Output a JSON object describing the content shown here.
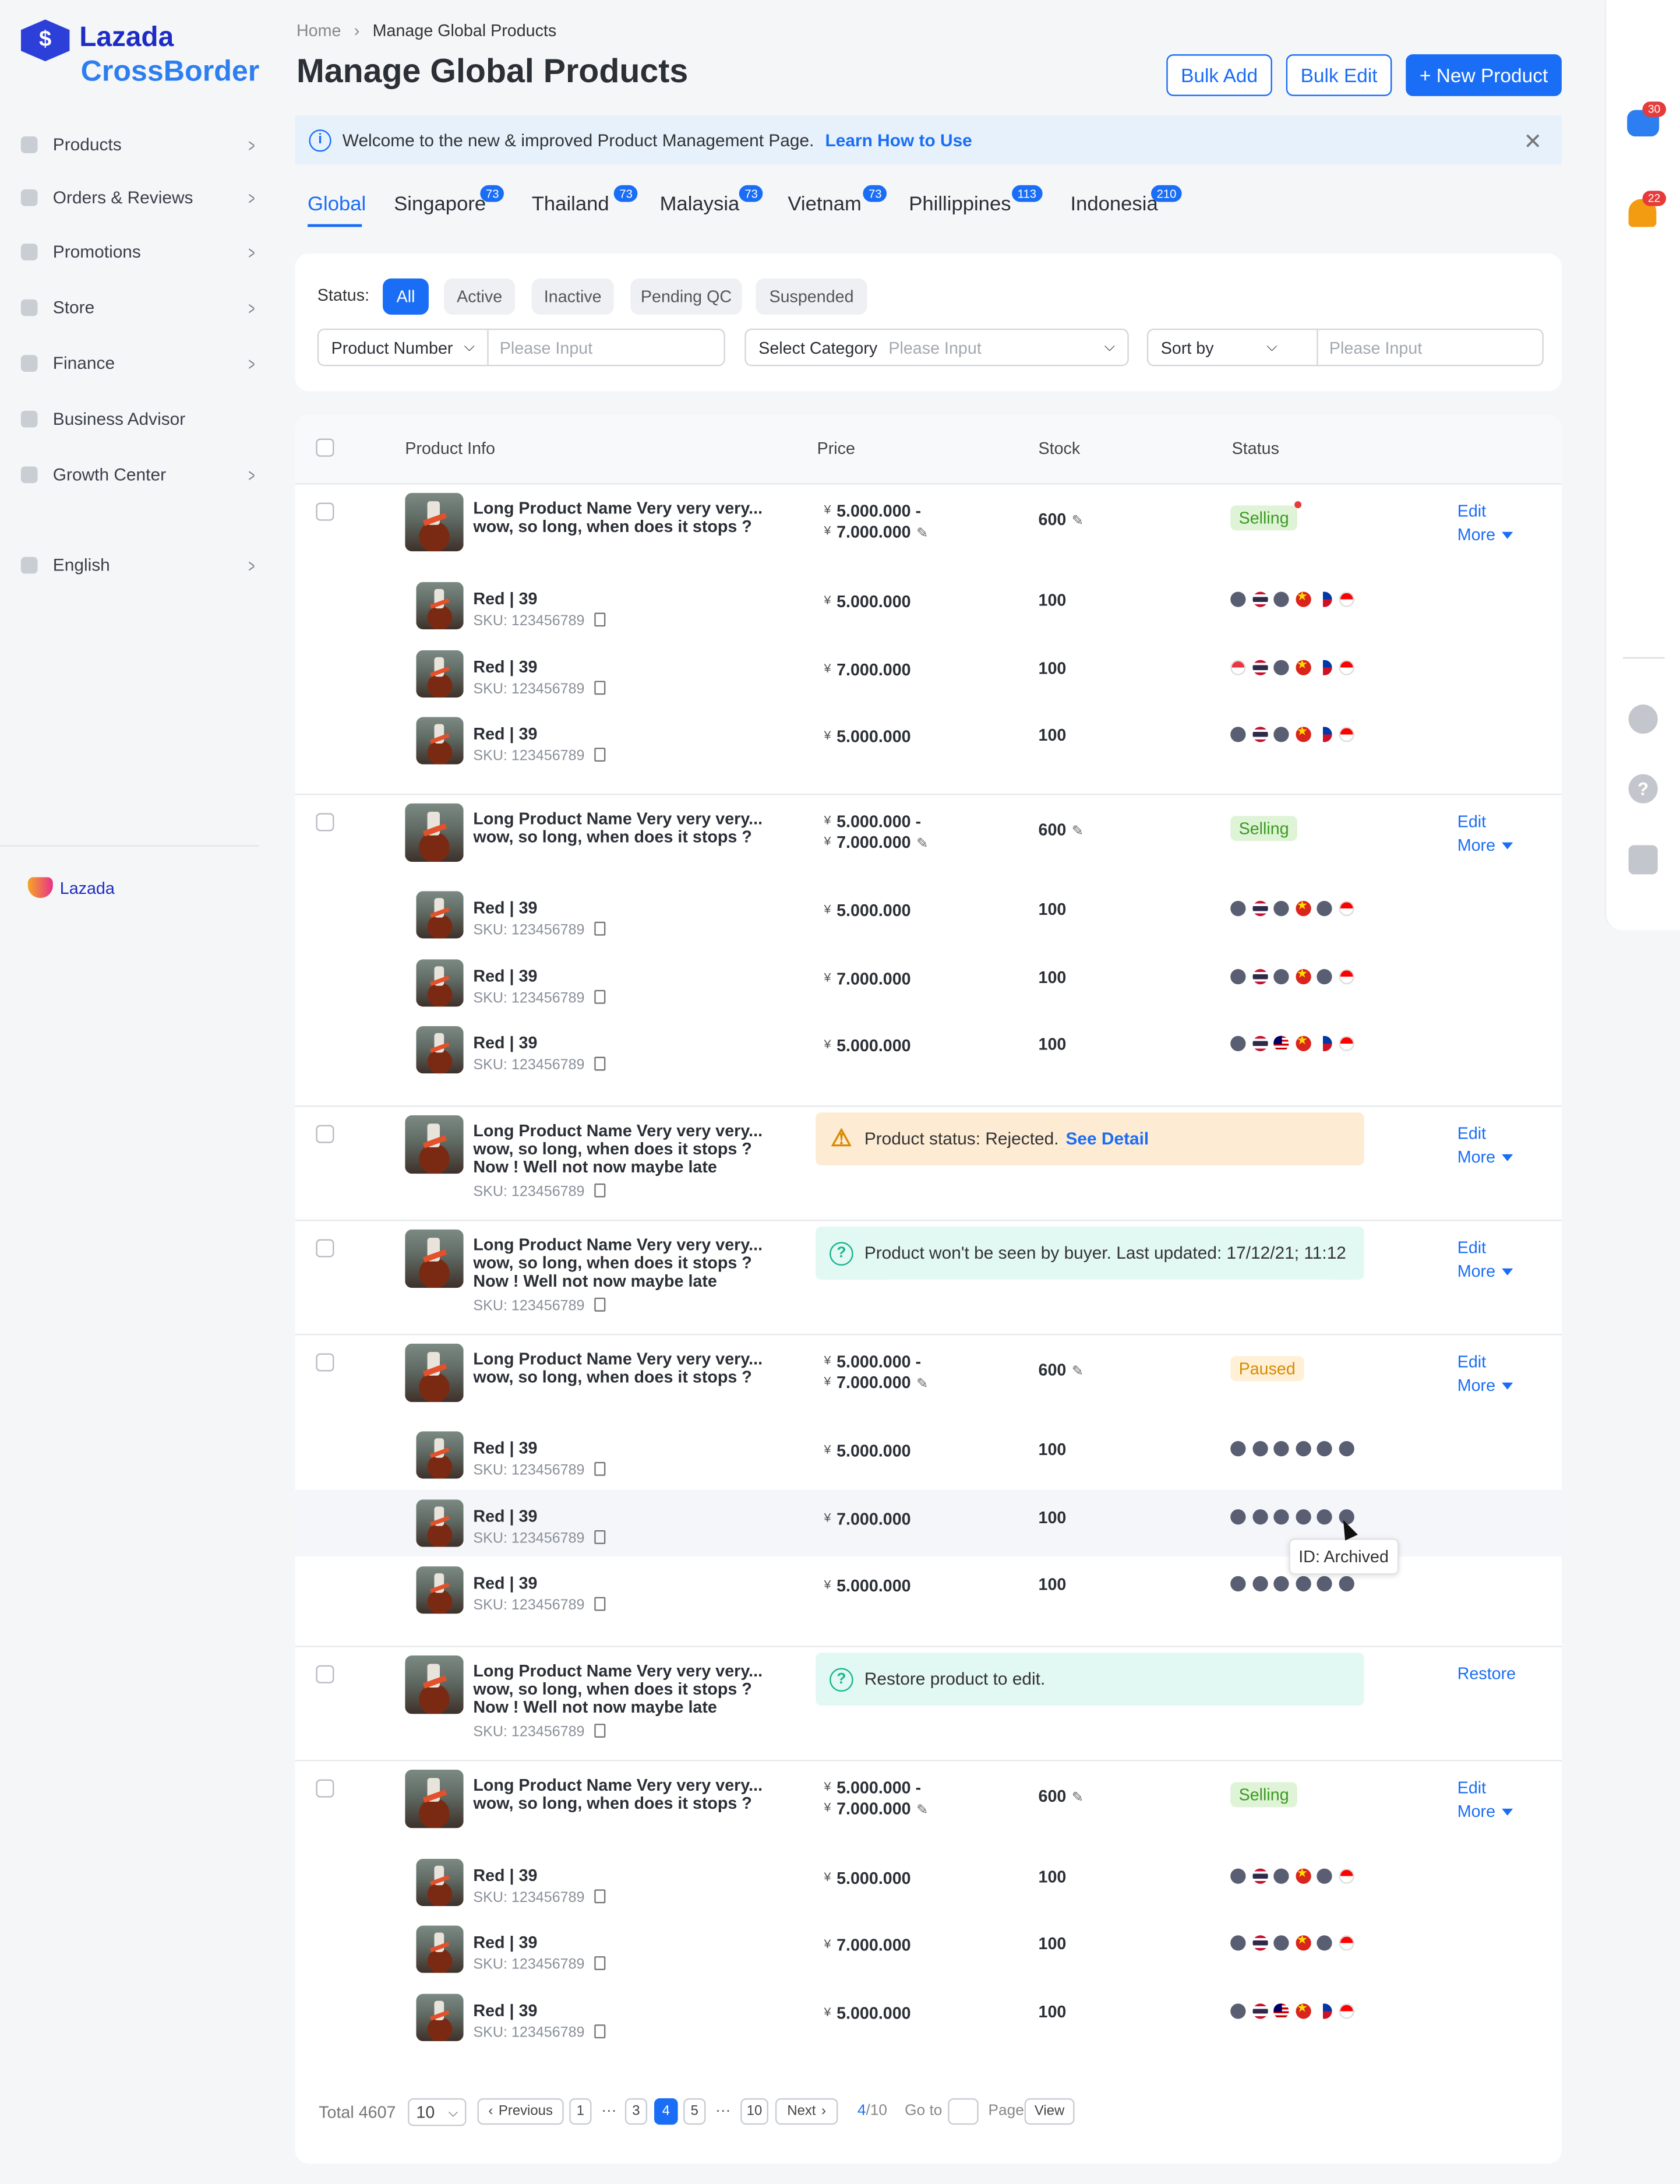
{
  "brand": {
    "name": "Lazada",
    "sub": "CrossBorder",
    "footer": "Lazada"
  },
  "sidebar": {
    "items": [
      {
        "label": "Products",
        "icon": "box-icon"
      },
      {
        "label": "Orders & Reviews",
        "icon": "orders-icon"
      },
      {
        "label": "Promotions",
        "icon": "promo-icon"
      },
      {
        "label": "Store",
        "icon": "store-icon"
      },
      {
        "label": "Finance",
        "icon": "finance-icon"
      },
      {
        "label": "Business Advisor",
        "icon": "advisor-icon"
      },
      {
        "label": "Growth Center",
        "icon": "growth-icon"
      },
      {
        "label": "English",
        "icon": "language-icon"
      }
    ]
  },
  "breadcrumb": {
    "home": "Home",
    "current": "Manage Global Products"
  },
  "title": "Manage Global Products",
  "buttons": {
    "bulk_add": "Bulk Add",
    "bulk_edit": "Bulk Edit",
    "new_product": "+ New Product"
  },
  "notice": {
    "text": "Welcome to the new & improved Product Management Page.",
    "link": "Learn How to Use"
  },
  "tabs": [
    {
      "label": "Global",
      "badge": ""
    },
    {
      "label": "Singapore",
      "badge": "73"
    },
    {
      "label": "Thailand",
      "badge": "73"
    },
    {
      "label": "Malaysia",
      "badge": "73"
    },
    {
      "label": "Vietnam",
      "badge": "73"
    },
    {
      "label": "Phillippines",
      "badge": "113"
    },
    {
      "label": "Indonesia",
      "badge": "210"
    }
  ],
  "filters": {
    "status_label": "Status:",
    "statuses": [
      "All",
      "Active",
      "Inactive",
      "Pending QC",
      "Suspended"
    ],
    "product_number": "Product Number",
    "placeholder": "Please Input",
    "category": "Select Category",
    "sort": "Sort by"
  },
  "table": {
    "headers": [
      "Product Info",
      "Price",
      "Stock",
      "Status"
    ]
  },
  "text": {
    "name": "Long Product Name Very very very...",
    "name2": "wow, so long, when does it stops ?",
    "name3": "Now ! Well not now maybe late",
    "sku": "SKU: 123456789",
    "variant": "Red | 39",
    "yen": "¥",
    "range1": "5.000.000 -",
    "range2": "7.000.000",
    "p5": "5.000.000",
    "p7": "7.000.000",
    "stock": "600",
    "vstock": "100",
    "edit": "Edit",
    "more": "More",
    "restore": "Restore",
    "selling": "Selling",
    "paused": "Paused"
  },
  "banners": {
    "rejected": "Product status: Rejected.",
    "see_detail": "See Detail",
    "hidden": "Product won't be seen by buyer. Last updated: 17/12/21; 11:12",
    "restore": "Restore product to edit."
  },
  "tooltip": "ID: Archived",
  "pagination": {
    "total": "Total 4607",
    "size": "10",
    "prev": "Previous",
    "next": "Next",
    "pages": [
      "1",
      "3",
      "4",
      "5",
      "10"
    ],
    "ellipsis": "···",
    "current": "4",
    "of": "/10",
    "goto": "Go to",
    "page": "Page",
    "view": "View"
  },
  "right_panel": {
    "chat_badge": "30",
    "bell_badge": "22"
  },
  "colors": {
    "primary": "#1a6ef5",
    "selling": "#3a9b22",
    "paused": "#d98a00"
  }
}
